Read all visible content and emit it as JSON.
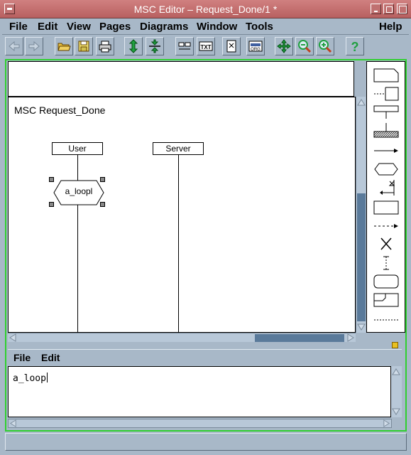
{
  "window": {
    "title": "MSC Editor – Request_Done/1 *"
  },
  "menubar": {
    "items": [
      "File",
      "Edit",
      "View",
      "Pages",
      "Diagrams",
      "Window",
      "Tools",
      "Help"
    ]
  },
  "toolbar": {
    "buttons": [
      "back-icon",
      "forward-icon",
      "open-folder-icon",
      "save-icon",
      "print-icon",
      "expand-vertical-icon",
      "compress-vertical-icon",
      "instance-icon",
      "text-icon",
      "delete-icon",
      "overview-icon",
      "move-icon",
      "zoom-out-icon",
      "zoom-in-icon",
      "help-icon"
    ]
  },
  "diagram": {
    "title": "MSC Request_Done",
    "instances": [
      {
        "name": "User"
      },
      {
        "name": "Server"
      }
    ],
    "loop_label": "a_loopl"
  },
  "palette": {
    "items": [
      "instance-symbol-icon",
      "comment-symbol-icon",
      "condition-symbol-icon",
      "environment-symbol-icon",
      "message-symbol-icon",
      "loop-symbol-icon",
      "timer-symbol-icon",
      "action-symbol-icon",
      "dashed-message-icon",
      "stop-symbol-icon",
      "coregion-symbol-icon",
      "rounded-symbol-icon",
      "reference-symbol-icon",
      "gate-line-icon"
    ]
  },
  "editor": {
    "menu": [
      "File",
      "Edit"
    ],
    "text": "a_loop"
  },
  "colors": {
    "accent_frame": "#30d030",
    "titlebar": "#c07070",
    "window_bg": "#a8b8c8"
  }
}
